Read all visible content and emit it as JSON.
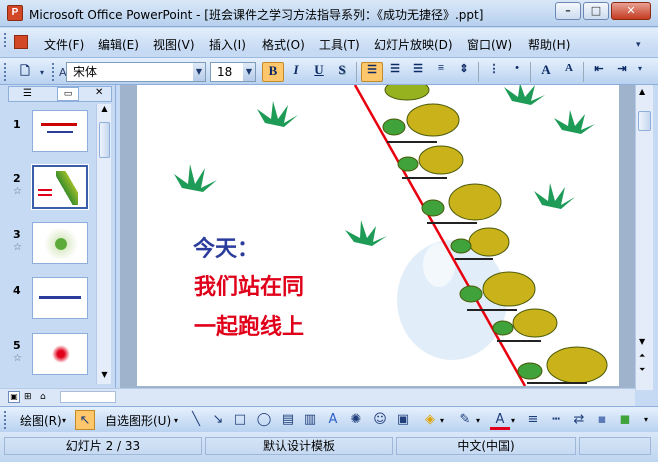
{
  "window": {
    "title": "Microsoft Office PowerPoint - [班会课件之学习方法指导系列：《成功无捷径》.ppt]"
  },
  "menu": [
    "文件(F)",
    "编辑(E)",
    "视图(V)",
    "插入(I)",
    "格式(O)",
    "工具(T)",
    "幻灯片放映(D)",
    "窗口(W)",
    "帮助(H)"
  ],
  "toolbar": {
    "font_name": "宋体",
    "font_size": "18",
    "bold": "B",
    "italic": "I",
    "underline": "U",
    "shadow": "S",
    "grow": "A",
    "shrink": "A"
  },
  "thumbs": [
    {
      "num": "1",
      "star": ""
    },
    {
      "num": "2",
      "star": "☆"
    },
    {
      "num": "3",
      "star": "☆"
    },
    {
      "num": "4",
      "star": ""
    },
    {
      "num": "5",
      "star": "☆"
    }
  ],
  "slide": {
    "line1": "今天：",
    "line2": "我们站在同",
    "line3": "一起跑线上",
    "colors": {
      "blue": "#2b3d9c",
      "red": "#e0001a",
      "line": "#e8000e"
    }
  },
  "drawbar": {
    "draw": "绘图(R)",
    "autoshapes": "自选图形(U)"
  },
  "status": {
    "slide": "幻灯片 2 / 33",
    "template": "默认设计模板",
    "lang": "中文(中国)"
  }
}
